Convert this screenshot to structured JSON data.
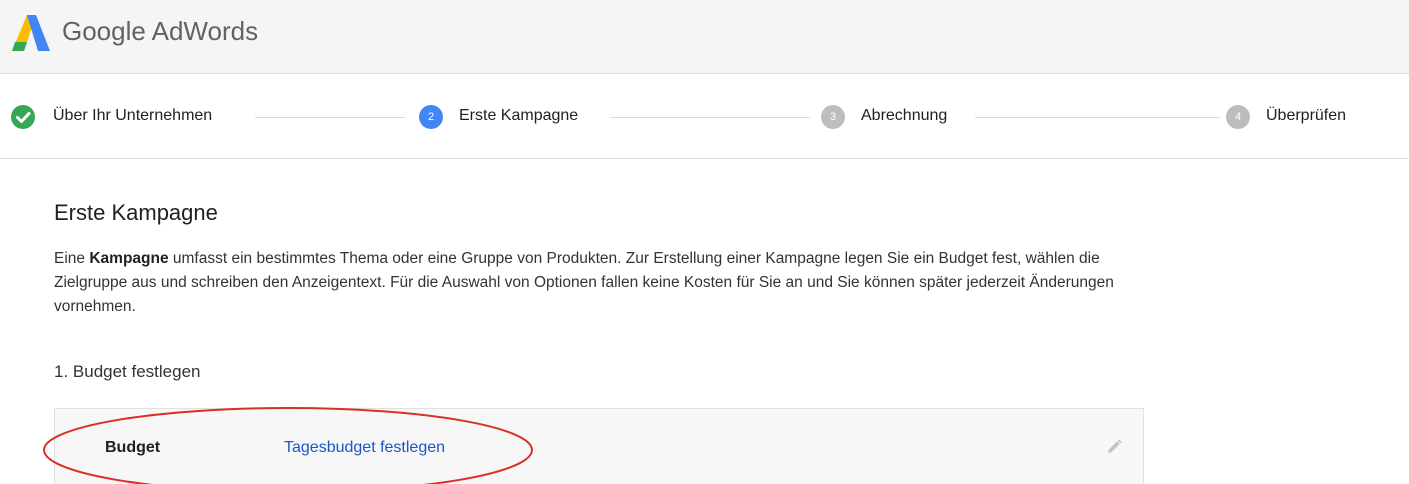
{
  "header": {
    "brand": "Google AdWords"
  },
  "stepper": {
    "steps": [
      {
        "number": "",
        "label": "Über Ihr Unternehmen",
        "state": "done"
      },
      {
        "number": "2",
        "label": "Erste Kampagne",
        "state": "active"
      },
      {
        "number": "3",
        "label": "Abrechnung",
        "state": "pending"
      },
      {
        "number": "4",
        "label": "Überprüfen",
        "state": "pending"
      }
    ]
  },
  "main": {
    "title": "Erste Kampagne",
    "description_prefix": "Eine ",
    "description_bold": "Kampagne",
    "description_rest": " umfasst ein bestimmtes Thema oder eine Gruppe von Produkten. Zur Erstellung einer Kampagne legen Sie ein Budget fest, wählen die Zielgruppe aus und schreiben den Anzeigentext. Für die Auswahl von Optionen fallen keine Kosten für Sie an und Sie können später jederzeit Änderungen vornehmen.",
    "section_title": "1. Budget festlegen",
    "budget": {
      "label": "Budget",
      "link_text": "Tagesbudget festlegen",
      "edit_icon": "pencil-icon"
    }
  },
  "colors": {
    "accent_blue": "#4285f4",
    "success_green": "#34a853",
    "link_blue": "#1a56c8",
    "annotation_red": "#d93025"
  }
}
